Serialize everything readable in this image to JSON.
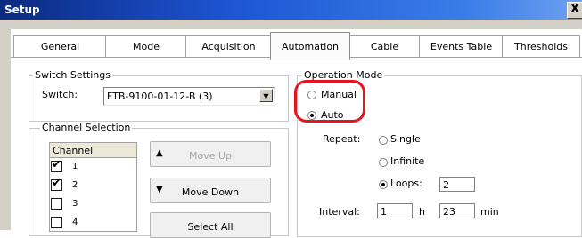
{
  "window": {
    "title": "Setup",
    "close_glyph": "X"
  },
  "tabs": [
    {
      "label": "General"
    },
    {
      "label": "Mode"
    },
    {
      "label": "Acquisition"
    },
    {
      "label": "Automation",
      "active": true
    },
    {
      "label": "Cable"
    },
    {
      "label": "Events Table"
    },
    {
      "label": "Thresholds"
    }
  ],
  "switch_settings": {
    "legend": "Switch Settings",
    "switch_label": "Switch:",
    "switch_value": "FTB-9100-01-12-B (3)",
    "dropdown_glyph": "▼"
  },
  "channel_selection": {
    "legend": "Channel Selection",
    "header": "Channel",
    "rows": [
      {
        "num": "1",
        "checked": "✔"
      },
      {
        "num": "2",
        "checked": "✔"
      },
      {
        "num": "3",
        "checked": ""
      },
      {
        "num": "4",
        "checked": ""
      }
    ],
    "move_up": "Move Up",
    "move_down": "Move Down",
    "select_all": "Select All",
    "up_glyph": "▲",
    "down_glyph": "▼"
  },
  "operation_mode": {
    "legend": "Operation Mode",
    "manual": "Manual",
    "auto": "Auto",
    "selected": "Auto",
    "repeat_label": "Repeat:",
    "single": "Single",
    "infinite": "Infinite",
    "loops": "Loops:",
    "loops_value": "2",
    "repeat_selected": "Loops",
    "interval_label": "Interval:",
    "hours_value": "1",
    "hours_unit": "h",
    "minutes_value": "23",
    "minutes_unit": "min"
  },
  "colors": {
    "title_bar": "#1d55d3",
    "highlight": "#e8141c"
  }
}
